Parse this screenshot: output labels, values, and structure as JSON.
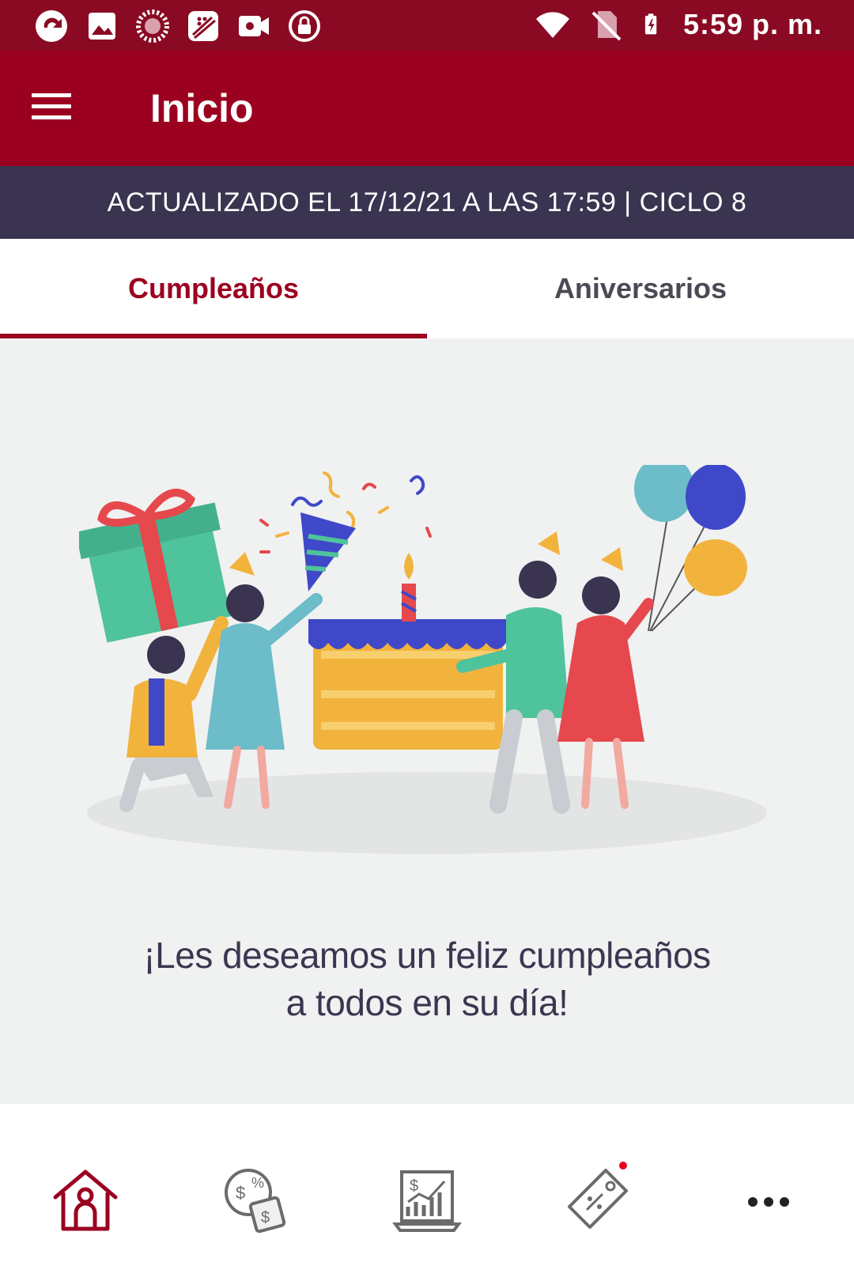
{
  "status_bar": {
    "time": "5:59 p. m.",
    "left_icons": [
      "app-icon",
      "image-icon",
      "loading-icon",
      "blackberry-icon",
      "video-icon",
      "lock-icon"
    ],
    "right_icons": [
      "wifi-icon",
      "no-sim-icon",
      "battery-charging-icon"
    ]
  },
  "app_bar": {
    "title": "Inicio",
    "menu_icon": "menu-icon"
  },
  "update_bar": {
    "text": "ACTUALIZADO EL 17/12/21 A LAS 17:59 | CICLO 8"
  },
  "tabs": [
    {
      "label": "Cumpleaños",
      "active": true
    },
    {
      "label": "Aniversarios",
      "active": false
    }
  ],
  "content": {
    "illustration": "birthday-party-illustration",
    "message_line1": "¡Les deseamos un feliz cumpleaños",
    "message_line2": "a todos en su día!"
  },
  "bottom_nav": [
    {
      "icon": "home-icon",
      "active": true
    },
    {
      "icon": "money-exchange-icon",
      "active": false
    },
    {
      "icon": "sales-chart-icon",
      "active": false
    },
    {
      "icon": "discount-tag-icon",
      "active": false,
      "badge": true
    },
    {
      "icon": "more-icon",
      "active": false
    }
  ],
  "colors": {
    "status_bar": "#8a0a23",
    "app_bar": "#9b0020",
    "update_bar": "#3a3450",
    "accent": "#9b0020",
    "content_bg": "#f0f1f1",
    "badge": "#e8001c"
  }
}
